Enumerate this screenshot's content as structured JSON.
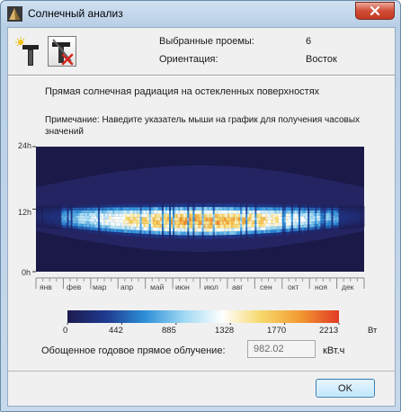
{
  "window": {
    "title": "Солнечный анализ"
  },
  "tools": [
    {
      "icon": "window-sun-icon"
    },
    {
      "icon": "window-shade-remove-icon"
    }
  ],
  "info": {
    "selected_openings_label": "Выбранные проемы:",
    "selected_openings_value": "6",
    "orientation_label": "Ориентация:",
    "orientation_value": "Восток"
  },
  "heading": "Прямая солнечная радиация на остекленных поверхностях",
  "note": "Примечание: Наведите указатель мыши на график для получения часовых значений",
  "chart_data": {
    "type": "heatmap",
    "y_ticks": [
      "24h",
      "12h",
      "0h"
    ],
    "ylim": [
      0,
      24
    ],
    "x_categories": [
      "янв",
      "фев",
      "мар",
      "апр",
      "май",
      "июн",
      "июл",
      "авг",
      "сен",
      "окт",
      "ноя",
      "дек"
    ],
    "colorbar": {
      "ticks": [
        "0",
        "442",
        "885",
        "1328",
        "1770",
        "2213"
      ],
      "unit": "Вт",
      "colors": [
        "#1d1b4f",
        "#1f3a8f",
        "#2d8fd8",
        "#9fd8f2",
        "#ffffff",
        "#f6d86a",
        "#f39a32",
        "#e03a24"
      ]
    }
  },
  "summary": {
    "label": "Обощенное годовое прямое облучение:",
    "value": "982.02",
    "unit": "кВт.ч"
  },
  "buttons": {
    "ok": "OK"
  }
}
